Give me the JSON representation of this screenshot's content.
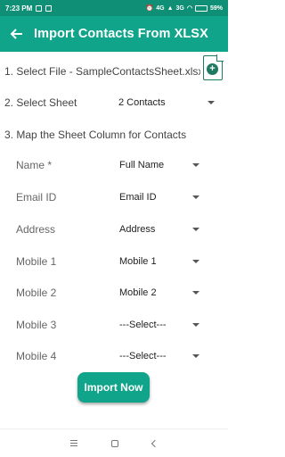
{
  "status_bar": {
    "time": "7:23 PM",
    "network_left": "4G",
    "network_right": "3G",
    "battery": "59%"
  },
  "app_bar": {
    "title": "Import Contacts From XLSX",
    "back_icon": "arrow-left-icon"
  },
  "step1": {
    "label": "1. Select File  -  SampleContactsSheet.xlsx"
  },
  "step2": {
    "label": "2. Select Sheet",
    "value": "2 Contacts"
  },
  "step3": {
    "label": "3. Map the Sheet Column for Contacts"
  },
  "fields": [
    {
      "label": "Name *",
      "value": "Full Name"
    },
    {
      "label": "Email ID",
      "value": "Email ID"
    },
    {
      "label": "Address",
      "value": "Address"
    },
    {
      "label": "Mobile 1",
      "value": "Mobile 1"
    },
    {
      "label": "Mobile 2",
      "value": "Mobile 2"
    },
    {
      "label": "Mobile 3",
      "value": "---Select---"
    },
    {
      "label": "Mobile 4",
      "value": "---Select---"
    }
  ],
  "import_button": {
    "label": "Import Now"
  },
  "colors": {
    "status_bar": "#0f8f75",
    "app_bar": "#10a58a",
    "button": "#10a58a",
    "icon": "#1f7a62"
  }
}
